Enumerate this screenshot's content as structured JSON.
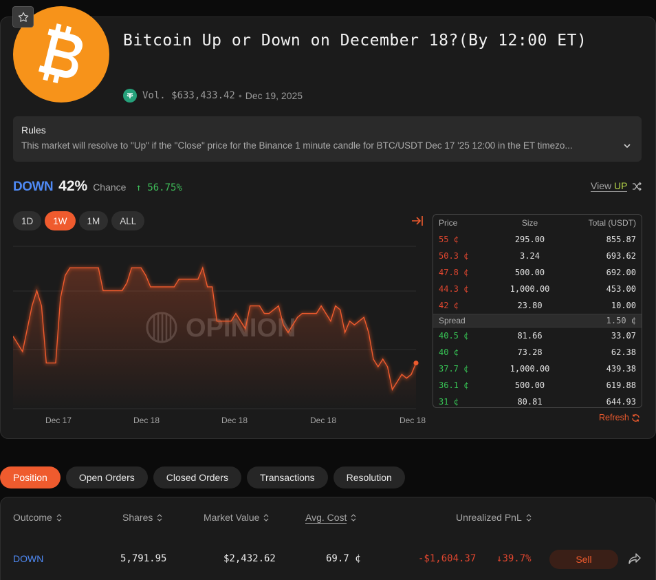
{
  "market": {
    "title": "Bitcoin Up or Down on December 18?(By 12:00 ET)",
    "volume": "Vol. $633,433.42",
    "date": "Dec 19, 2025",
    "rules_title": "Rules",
    "rules_text": "This market will resolve to \"Up\" if the \"Close\" price for the Binance 1 minute candle for BTC/USDT Dec 17 '25 12:00 in the ET timezo..."
  },
  "chance": {
    "outcome": "DOWN",
    "percent": "42%",
    "label": "Chance",
    "change": "56.75%",
    "view_label": "View",
    "view_outcome": "UP"
  },
  "ranges": [
    "1D",
    "1W",
    "1M",
    "ALL"
  ],
  "active_range": "1W",
  "watermark": "OPINION",
  "chart_data": {
    "type": "line",
    "x_tick_labels": [
      "Dec 17",
      "Dec 18",
      "Dec 18",
      "Dec 18",
      "Dec 18"
    ],
    "values": [
      54,
      52,
      50,
      56,
      62,
      66,
      62,
      47,
      47,
      47,
      64,
      70,
      72,
      72,
      72,
      72,
      72,
      72,
      72,
      66,
      66,
      66,
      66,
      66,
      68,
      72,
      72,
      72,
      70,
      67,
      67,
      67,
      67,
      67,
      67,
      69,
      69,
      69,
      69,
      69,
      72,
      67,
      67,
      58,
      58,
      58,
      58,
      60,
      58,
      56,
      62,
      62,
      62,
      60,
      60,
      61,
      62,
      57,
      55,
      57,
      59,
      60,
      60,
      60,
      60,
      62,
      60,
      58,
      62,
      61,
      55,
      58,
      57,
      58,
      59,
      55,
      48,
      46,
      48,
      46,
      40,
      42,
      44,
      43,
      44,
      47
    ],
    "ylim": [
      35,
      78
    ],
    "color": "#ef5b2e"
  },
  "orderbook": {
    "headers": {
      "price": "Price",
      "size": "Size",
      "total": "Total (USDT)"
    },
    "asks": [
      {
        "price": "55 ¢",
        "size": "295.00",
        "total": "855.87"
      },
      {
        "price": "50.3 ¢",
        "size": "3.24",
        "total": "693.62"
      },
      {
        "price": "47.8 ¢",
        "size": "500.00",
        "total": "692.00"
      },
      {
        "price": "44.3 ¢",
        "size": "1,000.00",
        "total": "453.00"
      },
      {
        "price": "42 ¢",
        "size": "23.80",
        "total": "10.00"
      }
    ],
    "spread_label": "Spread",
    "spread_value": "1.50 ¢",
    "bids": [
      {
        "price": "40.5 ¢",
        "size": "81.66",
        "total": "33.07"
      },
      {
        "price": "40 ¢",
        "size": "73.28",
        "total": "62.38"
      },
      {
        "price": "37.7 ¢",
        "size": "1,000.00",
        "total": "439.38"
      },
      {
        "price": "36.1 ¢",
        "size": "500.00",
        "total": "619.88"
      },
      {
        "price": "31 ¢",
        "size": "80.81",
        "total": "644.93"
      }
    ],
    "refresh_label": "Refresh"
  },
  "tabs": [
    "Position",
    "Open Orders",
    "Closed Orders",
    "Transactions",
    "Resolution"
  ],
  "active_tab": "Position",
  "positions": {
    "headers": {
      "outcome": "Outcome",
      "shares": "Shares",
      "market_value": "Market Value",
      "avg_cost": "Avg. Cost",
      "pnl": "Unrealized PnL"
    },
    "row": {
      "outcome": "DOWN",
      "shares": "5,791.95",
      "market_value": "$2,432.62",
      "avg_cost": "69.7 ¢",
      "pnl": "-$1,604.37",
      "pnl_pct": "39.7%",
      "sell_label": "Sell"
    }
  },
  "colors": {
    "accent": "#ef5b2e",
    "down": "#4f8af5",
    "up_text": "#b8d84a",
    "positive": "#3fbf5a",
    "negative": "#e0462f",
    "bitcoin": "#f7931a",
    "tether": "#26a17b"
  }
}
